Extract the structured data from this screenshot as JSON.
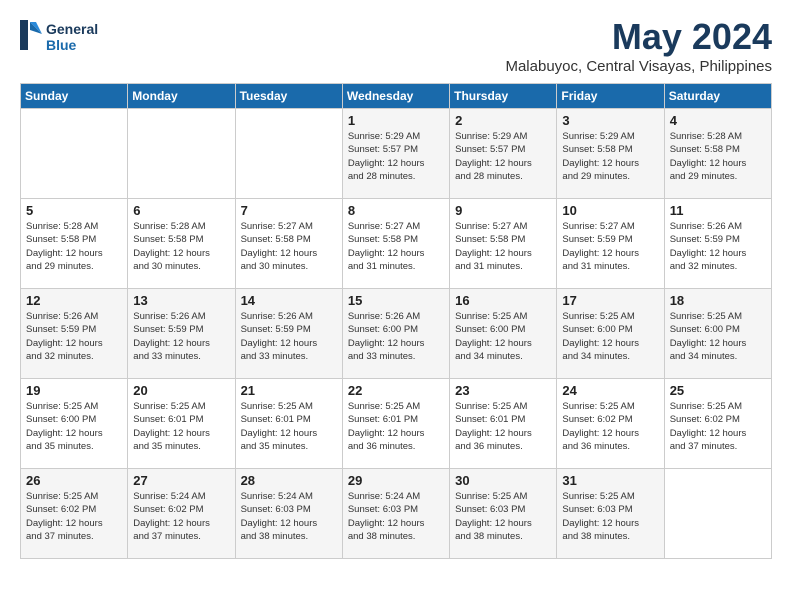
{
  "logo": {
    "line1": "General",
    "line2": "Blue"
  },
  "title": "May 2024",
  "subtitle": "Malabuyoc, Central Visayas, Philippines",
  "headers": [
    "Sunday",
    "Monday",
    "Tuesday",
    "Wednesday",
    "Thursday",
    "Friday",
    "Saturday"
  ],
  "weeks": [
    [
      {
        "day": "",
        "info": ""
      },
      {
        "day": "",
        "info": ""
      },
      {
        "day": "",
        "info": ""
      },
      {
        "day": "1",
        "info": "Sunrise: 5:29 AM\nSunset: 5:57 PM\nDaylight: 12 hours\nand 28 minutes."
      },
      {
        "day": "2",
        "info": "Sunrise: 5:29 AM\nSunset: 5:57 PM\nDaylight: 12 hours\nand 28 minutes."
      },
      {
        "day": "3",
        "info": "Sunrise: 5:29 AM\nSunset: 5:58 PM\nDaylight: 12 hours\nand 29 minutes."
      },
      {
        "day": "4",
        "info": "Sunrise: 5:28 AM\nSunset: 5:58 PM\nDaylight: 12 hours\nand 29 minutes."
      }
    ],
    [
      {
        "day": "5",
        "info": "Sunrise: 5:28 AM\nSunset: 5:58 PM\nDaylight: 12 hours\nand 29 minutes."
      },
      {
        "day": "6",
        "info": "Sunrise: 5:28 AM\nSunset: 5:58 PM\nDaylight: 12 hours\nand 30 minutes."
      },
      {
        "day": "7",
        "info": "Sunrise: 5:27 AM\nSunset: 5:58 PM\nDaylight: 12 hours\nand 30 minutes."
      },
      {
        "day": "8",
        "info": "Sunrise: 5:27 AM\nSunset: 5:58 PM\nDaylight: 12 hours\nand 31 minutes."
      },
      {
        "day": "9",
        "info": "Sunrise: 5:27 AM\nSunset: 5:58 PM\nDaylight: 12 hours\nand 31 minutes."
      },
      {
        "day": "10",
        "info": "Sunrise: 5:27 AM\nSunset: 5:59 PM\nDaylight: 12 hours\nand 31 minutes."
      },
      {
        "day": "11",
        "info": "Sunrise: 5:26 AM\nSunset: 5:59 PM\nDaylight: 12 hours\nand 32 minutes."
      }
    ],
    [
      {
        "day": "12",
        "info": "Sunrise: 5:26 AM\nSunset: 5:59 PM\nDaylight: 12 hours\nand 32 minutes."
      },
      {
        "day": "13",
        "info": "Sunrise: 5:26 AM\nSunset: 5:59 PM\nDaylight: 12 hours\nand 33 minutes."
      },
      {
        "day": "14",
        "info": "Sunrise: 5:26 AM\nSunset: 5:59 PM\nDaylight: 12 hours\nand 33 minutes."
      },
      {
        "day": "15",
        "info": "Sunrise: 5:26 AM\nSunset: 6:00 PM\nDaylight: 12 hours\nand 33 minutes."
      },
      {
        "day": "16",
        "info": "Sunrise: 5:25 AM\nSunset: 6:00 PM\nDaylight: 12 hours\nand 34 minutes."
      },
      {
        "day": "17",
        "info": "Sunrise: 5:25 AM\nSunset: 6:00 PM\nDaylight: 12 hours\nand 34 minutes."
      },
      {
        "day": "18",
        "info": "Sunrise: 5:25 AM\nSunset: 6:00 PM\nDaylight: 12 hours\nand 34 minutes."
      }
    ],
    [
      {
        "day": "19",
        "info": "Sunrise: 5:25 AM\nSunset: 6:00 PM\nDaylight: 12 hours\nand 35 minutes."
      },
      {
        "day": "20",
        "info": "Sunrise: 5:25 AM\nSunset: 6:01 PM\nDaylight: 12 hours\nand 35 minutes."
      },
      {
        "day": "21",
        "info": "Sunrise: 5:25 AM\nSunset: 6:01 PM\nDaylight: 12 hours\nand 35 minutes."
      },
      {
        "day": "22",
        "info": "Sunrise: 5:25 AM\nSunset: 6:01 PM\nDaylight: 12 hours\nand 36 minutes."
      },
      {
        "day": "23",
        "info": "Sunrise: 5:25 AM\nSunset: 6:01 PM\nDaylight: 12 hours\nand 36 minutes."
      },
      {
        "day": "24",
        "info": "Sunrise: 5:25 AM\nSunset: 6:02 PM\nDaylight: 12 hours\nand 36 minutes."
      },
      {
        "day": "25",
        "info": "Sunrise: 5:25 AM\nSunset: 6:02 PM\nDaylight: 12 hours\nand 37 minutes."
      }
    ],
    [
      {
        "day": "26",
        "info": "Sunrise: 5:25 AM\nSunset: 6:02 PM\nDaylight: 12 hours\nand 37 minutes."
      },
      {
        "day": "27",
        "info": "Sunrise: 5:24 AM\nSunset: 6:02 PM\nDaylight: 12 hours\nand 37 minutes."
      },
      {
        "day": "28",
        "info": "Sunrise: 5:24 AM\nSunset: 6:03 PM\nDaylight: 12 hours\nand 38 minutes."
      },
      {
        "day": "29",
        "info": "Sunrise: 5:24 AM\nSunset: 6:03 PM\nDaylight: 12 hours\nand 38 minutes."
      },
      {
        "day": "30",
        "info": "Sunrise: 5:25 AM\nSunset: 6:03 PM\nDaylight: 12 hours\nand 38 minutes."
      },
      {
        "day": "31",
        "info": "Sunrise: 5:25 AM\nSunset: 6:03 PM\nDaylight: 12 hours\nand 38 minutes."
      },
      {
        "day": "",
        "info": ""
      }
    ]
  ]
}
